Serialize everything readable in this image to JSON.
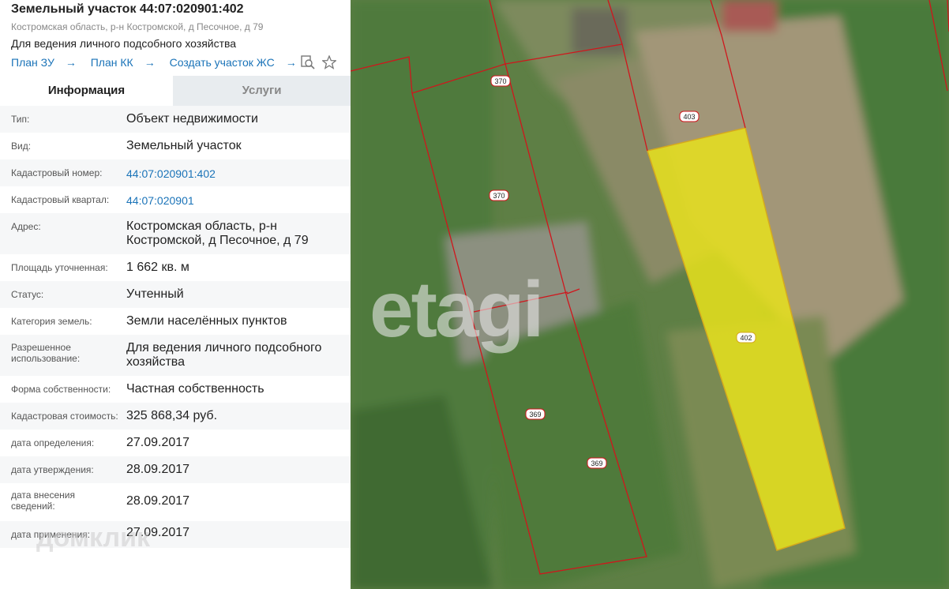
{
  "header": {
    "title": "Земельный участок 44:07:020901:402",
    "address": "Костромская область, р-н Костромской, д Песочное, д 79",
    "usage": "Для ведения личного подсобного хозяйства",
    "links": [
      "План ЗУ",
      "План КК",
      "Создать участок ЖС"
    ],
    "link_arrow": "→"
  },
  "tabs": {
    "info": "Информация",
    "services": "Услуги"
  },
  "rows": [
    {
      "key": "Тип:",
      "value": "Объект недвижимости"
    },
    {
      "key": "Вид:",
      "value": "Земельный участок"
    },
    {
      "key": "Кадастровый номер:",
      "value": "44:07:020901:402"
    },
    {
      "key": "Кадастровый квартал:",
      "value": "44:07:020901"
    },
    {
      "key": "Адрес:",
      "value": "Костромская область, р-н Костромской, д Песочное, д 79"
    },
    {
      "key": "Площадь уточненная:",
      "value": "1 662 кв. м"
    },
    {
      "key": "Статус:",
      "value": "Учтенный"
    },
    {
      "key": "Категория земель:",
      "value": "Земли населённых пунктов"
    },
    {
      "key": "Разрешенное использование:",
      "value": "Для ведения личного подсобного хозяйства"
    },
    {
      "key": "Форма собственности:",
      "value": "Частная собственность"
    },
    {
      "key": "Кадастровая стоимость:",
      "value": "325 868,34 руб."
    },
    {
      "key": "дата определения:",
      "value": "27.09.2017"
    },
    {
      "key": "дата утверждения:",
      "value": "28.09.2017"
    },
    {
      "key": "дата внесения сведений:",
      "value": "28.09.2017"
    },
    {
      "key": "дата применения:",
      "value": "27.09.2017"
    }
  ],
  "map": {
    "parcel_labels": [
      "370",
      "370",
      "403",
      "402",
      "369",
      "369"
    ],
    "selected_parcel": "402",
    "border_color": "#d0161c",
    "selected_fill": "#e8e21c"
  },
  "watermarks": {
    "etagi": "etagi",
    "domclick": "домклик"
  },
  "colors": {
    "link": "#1a73b8",
    "tab_bg": "#e8ecef"
  }
}
